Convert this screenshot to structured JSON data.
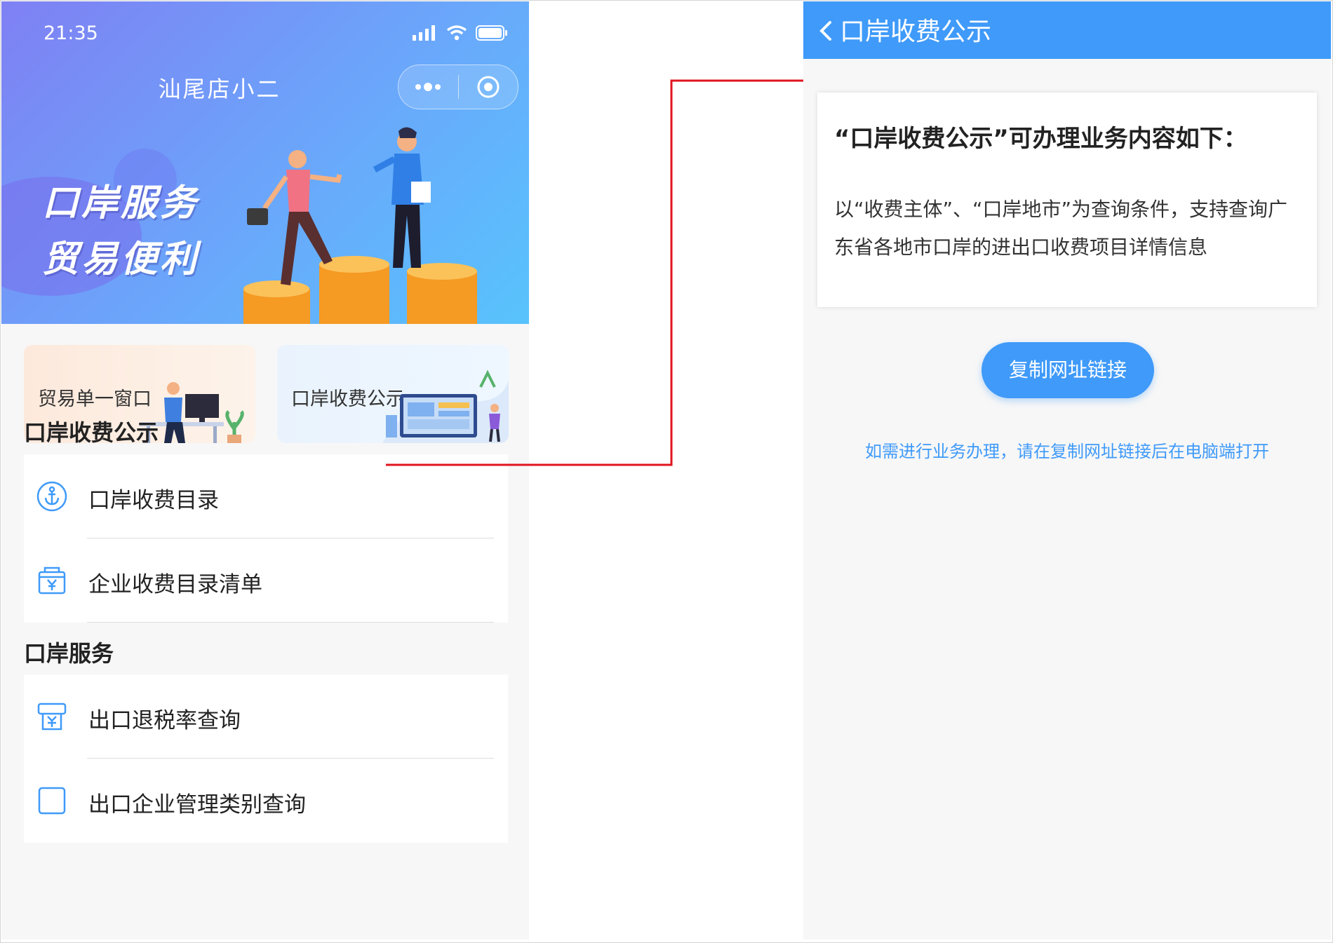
{
  "left_screen": {
    "status_time": "21:35",
    "mini_program_title": "汕尾店小二",
    "banner_slogan_line1": "口岸服务",
    "banner_slogan_line2": "贸易便利",
    "cards": [
      {
        "label": "贸易单一窗口"
      },
      {
        "label": "口岸收费公示"
      }
    ],
    "sections": [
      {
        "title": "口岸收费公示",
        "items": [
          {
            "label": "口岸收费目录",
            "icon": "anchor-icon"
          },
          {
            "label": "企业收费目录清单",
            "icon": "yen-bag-icon"
          }
        ]
      },
      {
        "title": "口岸服务",
        "items": [
          {
            "label": "出口退税率查询",
            "icon": "tax-receipt-icon"
          },
          {
            "label": "出口企业管理类别查询",
            "icon": "category-icon"
          }
        ]
      }
    ]
  },
  "right_screen": {
    "nav_title": "口岸收费公示",
    "info_heading": "“口岸收费公示”可办理业务内容如下：",
    "info_text": "以“收费主体”、“口岸地市”为查询条件，支持查询广东省各地市口岸的进出口收费项目详情信息",
    "copy_button": "复制网址链接",
    "tip": "如需进行业务办理，请在复制网址链接后在电脑端打开"
  },
  "colors": {
    "accent": "#3f9af9",
    "arrow": "#e0141e"
  }
}
